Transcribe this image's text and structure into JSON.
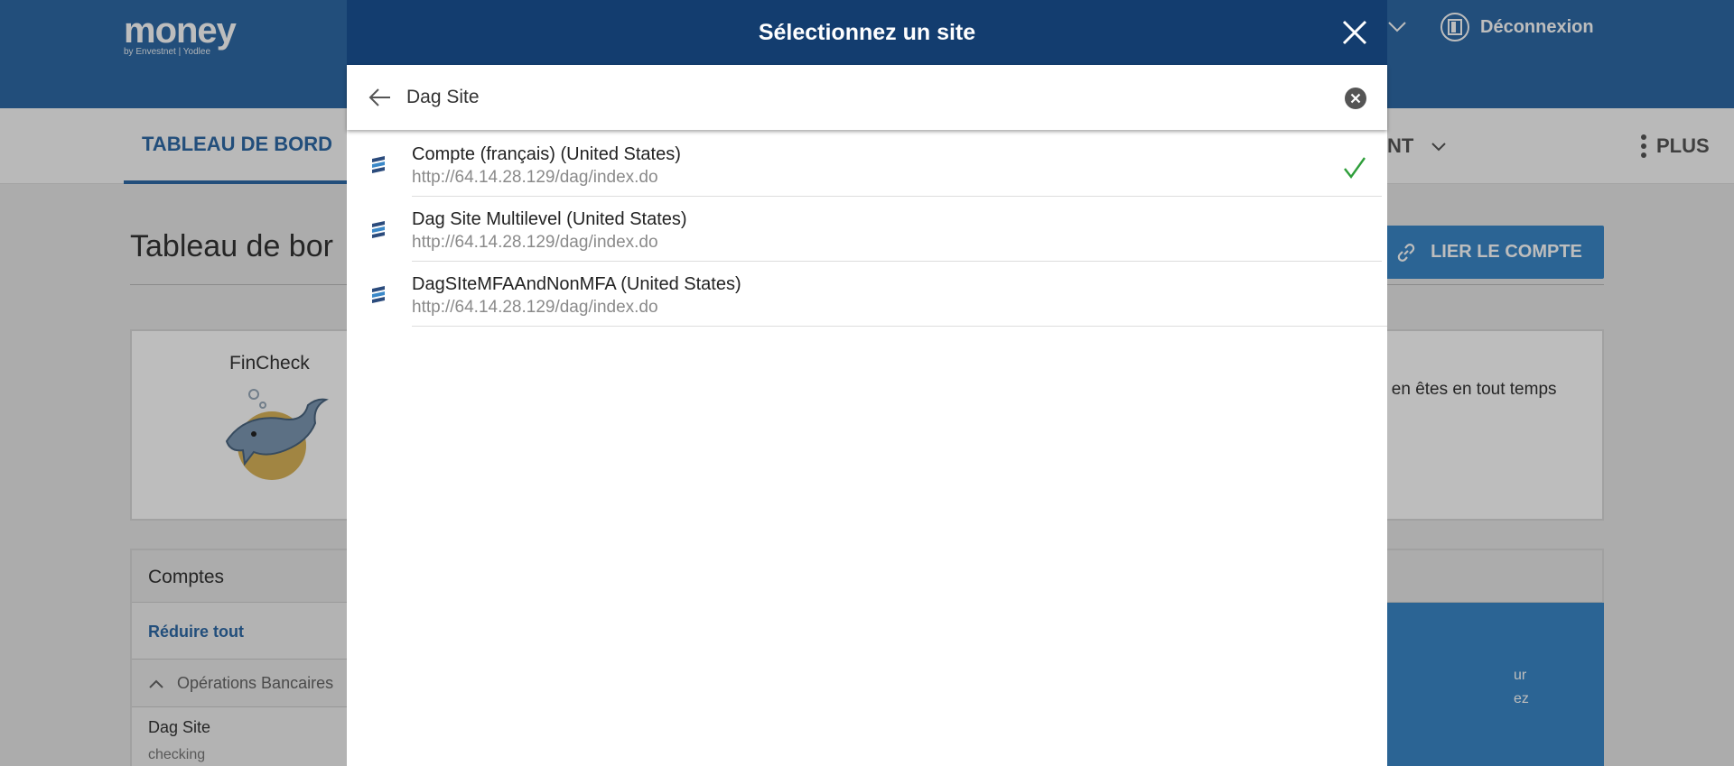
{
  "app": {
    "logo_word": "money",
    "logo_sub": "by Envestnet | Yodlee",
    "logout_label": "Déconnexion"
  },
  "nav": {
    "active_tab": "TABLEAU DE BORD",
    "partial_tab": "NT",
    "more_label": "PLUS"
  },
  "dashboard": {
    "title": "Tableau de bor",
    "link_account_label": "LIER LE COMPTE",
    "fincheck": {
      "title": "FinCheck",
      "text": "s en êtes en tout temps"
    },
    "accounts": {
      "title": "Comptes",
      "collapse_all": "Réduire tout",
      "section": "Opérations Bancaires",
      "account_name": "Dag Site",
      "account_type": "checking",
      "panel_line1": "ur",
      "panel_line2": "ez"
    }
  },
  "modal": {
    "title": "Sélectionnez un site",
    "search_value": "Dag Site",
    "results": [
      {
        "name": "Compte (français) (United States)",
        "url": "http://64.14.28.129/dag/index.do",
        "selected": true
      },
      {
        "name": "Dag Site Multilevel (United States)",
        "url": "http://64.14.28.129/dag/index.do",
        "selected": false
      },
      {
        "name": "DagSIteMFAAndNonMFA (United States)",
        "url": "http://64.14.28.129/dag/index.do",
        "selected": false
      }
    ]
  },
  "colors": {
    "header_blue": "#2f6aa7",
    "modal_header": "#133d6f",
    "accent": "#3a88c8",
    "check_green": "#2e9e3a"
  }
}
